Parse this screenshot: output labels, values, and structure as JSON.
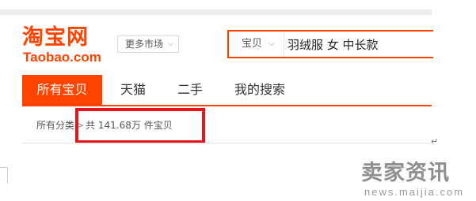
{
  "logo": {
    "chinese": "淘宝网",
    "english": "Taobao.com"
  },
  "market_button": {
    "label": "更多市场",
    "chevron": "⌵"
  },
  "search": {
    "category": "宝贝",
    "chevron": "⌵",
    "query": "羽绒服 女 中长款"
  },
  "tabs": [
    {
      "label": "所有宝贝",
      "active": true
    },
    {
      "label": "天猫",
      "active": false
    },
    {
      "label": "二手",
      "active": false
    },
    {
      "label": "我的搜索",
      "active": false
    }
  ],
  "breadcrumb": {
    "root": "所有分类",
    "separator": ">",
    "result_count": "共 141.68万 件宝贝"
  },
  "return_mark": "↵",
  "watermark": {
    "chinese": "卖家资讯",
    "english": "news.maijia.com"
  },
  "colors": {
    "accent": "#ff4400",
    "highlight_box": "#e8141a"
  }
}
